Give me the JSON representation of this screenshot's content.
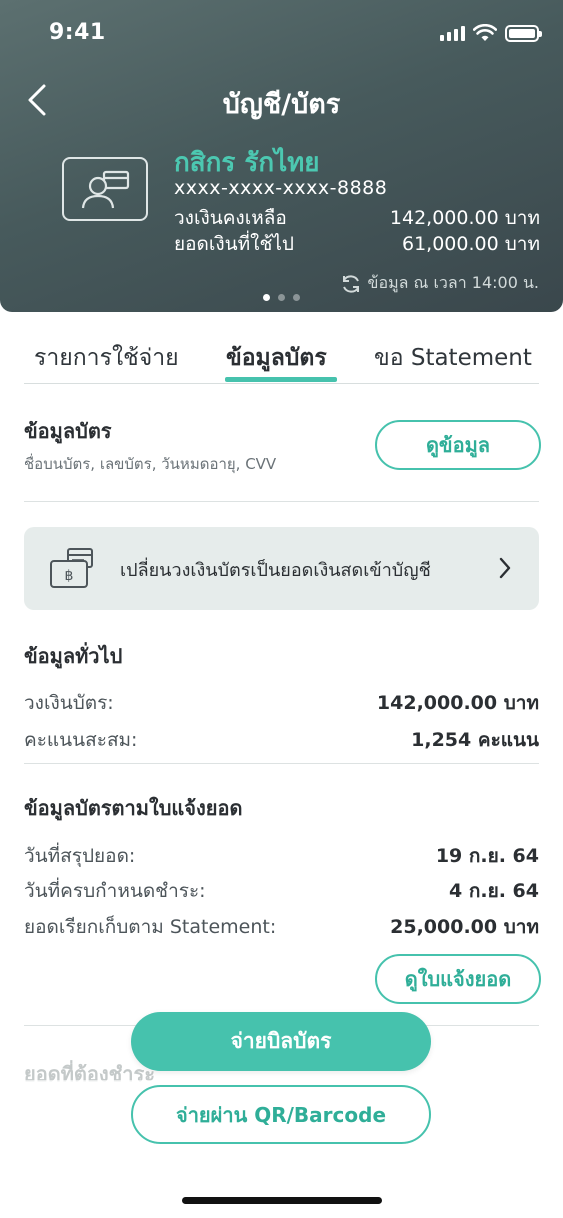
{
  "status": {
    "time": "9:41"
  },
  "header": {
    "title": "บัญชี/บัตร",
    "card_name": "กสิกร รักไทย",
    "card_number": "xxxx-xxxx-xxxx-8888",
    "limit_remaining_label": "วงเงินคงเหลือ",
    "limit_remaining_value": "142,000.00 บาท",
    "spent_label": "ยอดเงินที่ใช้ไป",
    "spent_value": "61,000.00 บาท",
    "updated_text": "ข้อมูล ณ เวลา 14:00 น.",
    "pager": {
      "count": 3,
      "active": 1
    }
  },
  "tabs": [
    {
      "label": "รายการใช้จ่าย"
    },
    {
      "label": "ข้อมูลบัตร"
    },
    {
      "label": "ขอ Statement"
    }
  ],
  "card_info": {
    "title": "ข้อมูลบัตร",
    "subtitle": "ชื่อบนบัตร, เลขบัตร, วันหมดอายุ, CVV",
    "button": "ดูข้อมูล"
  },
  "promo": {
    "text": "เปลี่ยนวงเงินบัตรเป็นยอดเงินสดเข้าบัญชี"
  },
  "general": {
    "title": "ข้อมูลทั่วไป",
    "rows": [
      {
        "label": "วงเงินบัตร:",
        "value": "142,000.00 บาท"
      },
      {
        "label": "คะแนนสะสม:",
        "value": "1,254 คะแนน"
      }
    ]
  },
  "statement": {
    "title": "ข้อมูลบัตรตามใบแจ้งยอด",
    "rows": [
      {
        "label": "วันที่สรุปยอด:",
        "value": "19 ก.ย. 64"
      },
      {
        "label": "วันที่ครบกำหนดชำระ:",
        "value": "4 ก.ย. 64"
      },
      {
        "label": "ยอดเรียกเก็บตาม Statement:",
        "value": "25,000.00 บาท"
      }
    ],
    "button": "ดูใบแจ้งยอด"
  },
  "due": {
    "title": "ยอดที่ต้องชำระ"
  },
  "actions": {
    "pay_bill": "จ่ายบิลบัตร",
    "pay_qr": "จ่ายผ่าน QR/Barcode"
  },
  "colors": {
    "accent": "#46c2ad",
    "header_bg": "#4a5c5e",
    "card_name": "#4cc8b1"
  }
}
